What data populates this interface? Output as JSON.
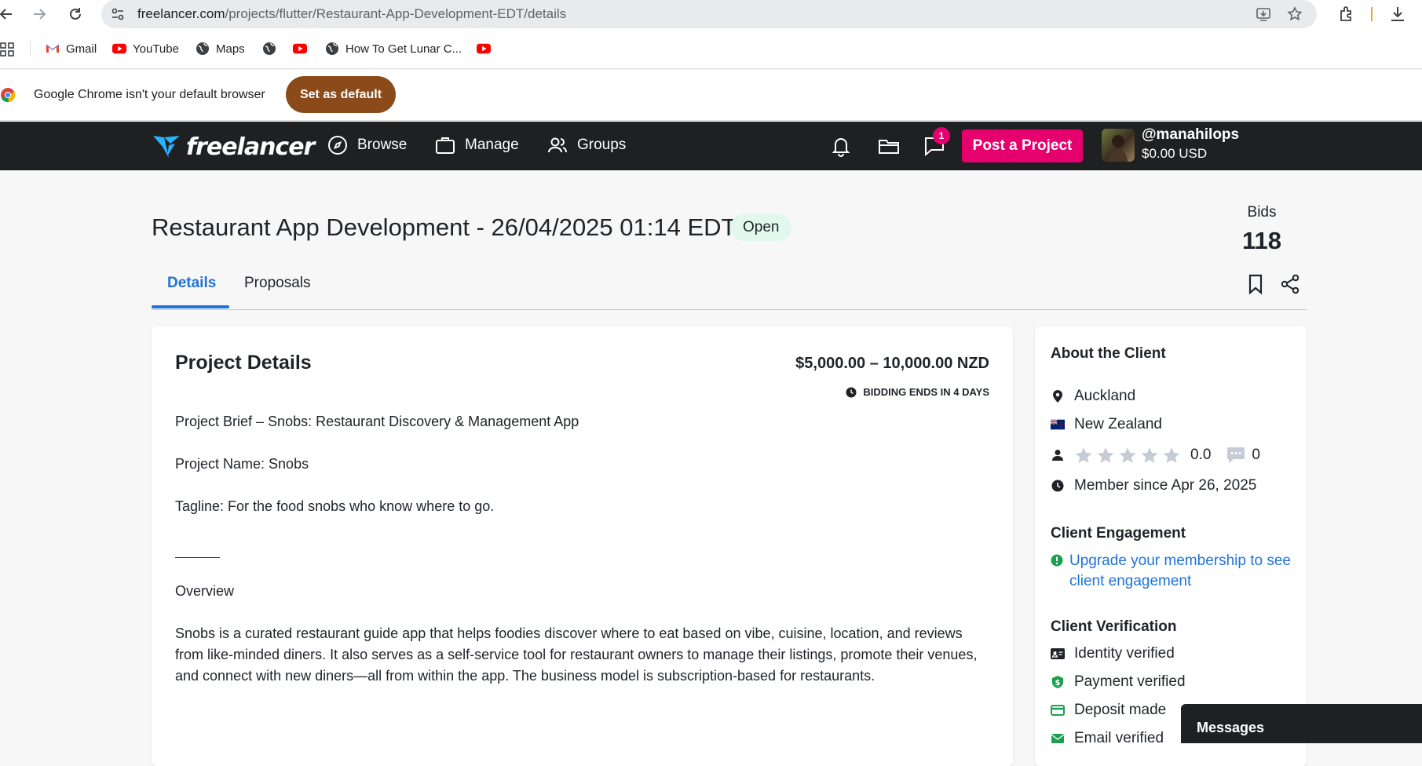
{
  "browser": {
    "url_host": "freelancer.com",
    "url_path": "/projects/flutter/Restaurant-App-Development-EDT/details",
    "bookmarks": [
      {
        "label": "Gmail",
        "icon": "gmail-icon"
      },
      {
        "label": "YouTube",
        "icon": "youtube-icon"
      },
      {
        "label": "Maps",
        "icon": "globe-icon"
      },
      {
        "label": "",
        "icon": "globe-icon"
      },
      {
        "label": "",
        "icon": "youtube-icon"
      },
      {
        "label": "How To Get Lunar C...",
        "icon": "globe-icon"
      },
      {
        "label": "",
        "icon": "youtube-icon"
      }
    ],
    "infobar_text": "Google Chrome isn't your default browser",
    "infobar_button": "Set as default"
  },
  "nav": {
    "logo_text": "freelancer",
    "items": [
      {
        "label": "Browse",
        "icon": "compass-icon"
      },
      {
        "label": "Manage",
        "icon": "briefcase-icon"
      },
      {
        "label": "Groups",
        "icon": "users-icon"
      }
    ],
    "messages_badge": "1",
    "post_button": "Post a Project",
    "username": "@manahilops",
    "balance": "$0.00 USD"
  },
  "header": {
    "title": "Restaurant App Development - 26/04/2025 01:14 EDT",
    "status": "Open",
    "bids_label": "Bids",
    "bids_value": "118",
    "tabs": [
      {
        "label": "Details",
        "active": true
      },
      {
        "label": "Proposals",
        "active": false
      }
    ]
  },
  "project": {
    "section_title": "Project Details",
    "budget": "$5,000.00 – 10,000.00 NZD",
    "bidding_ends": "BIDDING ENDS IN 4 DAYS",
    "brief": "Project Brief – Snobs: Restaurant Discovery & Management App",
    "name": "Project Name: Snobs",
    "tagline": "Tagline: For the food snobs who know where to go.",
    "overview_heading": "Overview",
    "overview": "Snobs is a curated restaurant guide app that helps foodies discover where to eat based on vibe, cuisine, location, and reviews from like-minded diners. It also serves as a self-service tool for restaurant owners to manage their listings, promote their venues, and connect with new diners—all from within the app. The business model is subscription-based for restaurants."
  },
  "client": {
    "about_title": "About the Client",
    "city": "Auckland",
    "country": "New Zealand",
    "rating": "0.0",
    "reviews": "0",
    "member_since": "Member since Apr 26, 2025",
    "engagement_title": "Client Engagement",
    "engagement_link": "Upgrade your membership to see client engagement",
    "verification_title": "Client Verification",
    "verifications": [
      "Identity verified",
      "Payment verified",
      "Deposit made",
      "Email verified"
    ]
  },
  "messages_panel": {
    "label": "Messages"
  },
  "colors": {
    "nav_bg": "#1f2022",
    "accent_pink": "#e5006d",
    "link_blue": "#1e73d8",
    "open_pill": "#e3f8ec",
    "set_default_btn": "#8a4a1a"
  }
}
